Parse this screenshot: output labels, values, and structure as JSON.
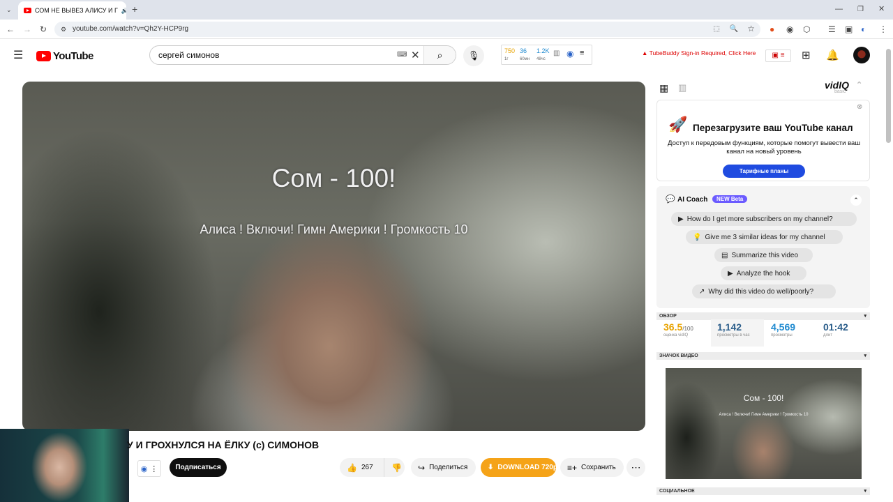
{
  "browser": {
    "tab_title": "СОМ НЕ ВЫВЕЗ АЛИСУ И Г",
    "url": "youtube.com/watch?v=Qh2Y-HCP9rg"
  },
  "header": {
    "logo_text": "YouTube",
    "search_value": "сергей симонов",
    "stats": [
      {
        "value": "750",
        "unit": "1г",
        "color": "#e8a300"
      },
      {
        "value": "36",
        "unit": "60мн",
        "color": "#1f8ad0"
      },
      {
        "value": "1.2K",
        "unit": "48чс",
        "color": "#1f8ad0"
      }
    ],
    "tubebuddy_text": "TubeBuddy Sign-in Required, Click Here"
  },
  "video": {
    "overlay_title": "Сом - 100!",
    "overlay_subtitle": "Алиса ! Включи! Гимн Америки ! Громкость 10",
    "title": "У И ГРОХНУЛСЯ НА ЁЛКУ (с) СИМОНОВ",
    "subscribe_label": "Подписаться",
    "likes": "267",
    "share_label": "Поделиться",
    "download_label": "DOWNLOAD 720p",
    "save_label": "Сохранить"
  },
  "sidebar": {
    "vidiq_logo": "vidIQ",
    "vidiq_plan": "basic",
    "promo_title": "Перезагрузите ваш YouTube канал",
    "promo_desc": "Доступ к передовым функциям, которые помогут вывести ваш канал на новый уровень",
    "promo_button": "Тарифные планы",
    "coach_title": "AI Coach",
    "coach_badge": "NEW Beta",
    "questions": [
      "How do I get more subscribers on my channel?",
      "Give me 3 similar ideas for my channel",
      "Summarize this video",
      "Analyze the hook",
      "Why did this video do well/poorly?"
    ],
    "overview_header": "ОБЗОР",
    "overview": {
      "score_value": "36.5",
      "score_suffix": "/100",
      "score_label": "оценка vidIQ",
      "vph_value": "1,142",
      "vph_label": "просмотры в час",
      "views_value": "4,569",
      "views_label": "просмотры",
      "length_value": "01:42",
      "length_label": "длит"
    },
    "thumb_header": "ЗНАЧОК ВИДЕО",
    "thumb_title": "Сом - 100!",
    "thumb_subtitle": "Алиса ! Включи! Гимн Америки ! Громкость 10",
    "social_header": "СОЦИАЛЬНОЕ"
  }
}
